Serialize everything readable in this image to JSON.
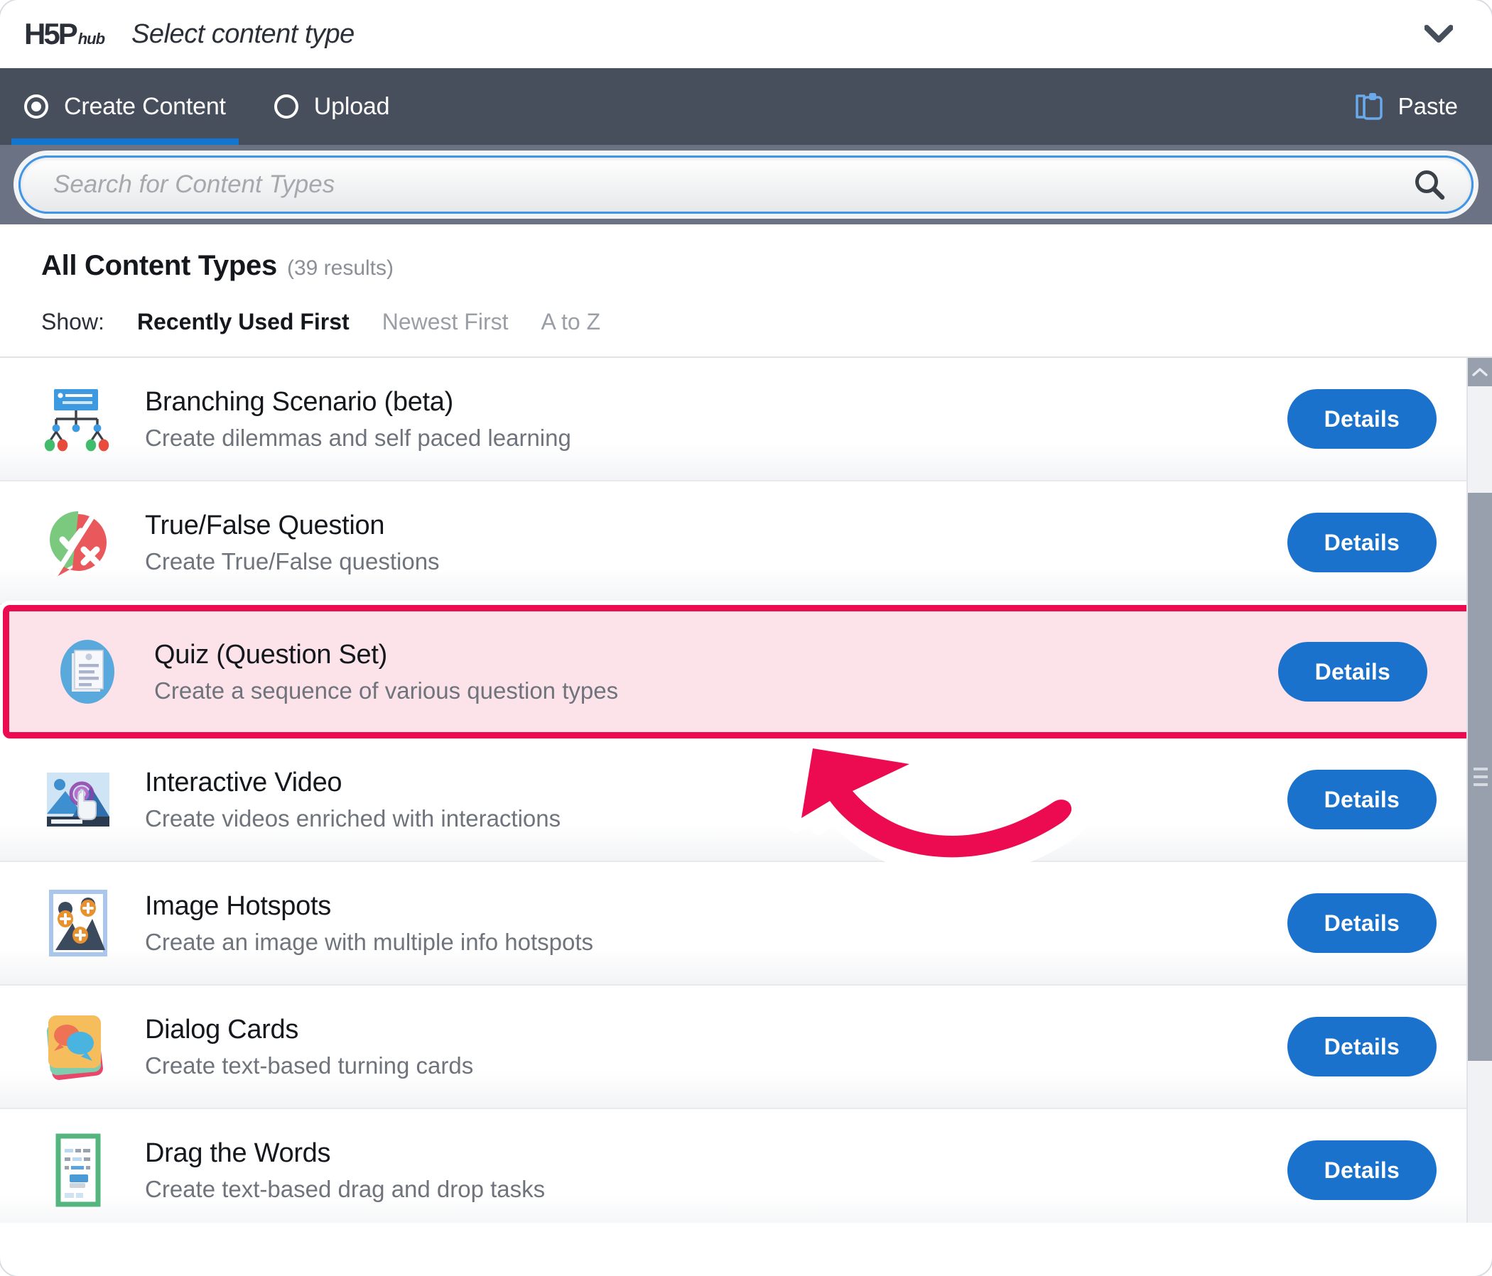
{
  "header": {
    "logo_main": "H5P",
    "logo_sub": "hub",
    "title": "Select content type",
    "collapse_icon": "chevron-down-icon"
  },
  "tabs": [
    {
      "label": "Create Content",
      "selected": true,
      "icon": "radio-selected-icon"
    },
    {
      "label": "Upload",
      "selected": false,
      "icon": "radio-unselected-icon"
    }
  ],
  "paste": {
    "label": "Paste",
    "icon": "clipboard-paste-icon"
  },
  "search": {
    "placeholder": "Search for Content Types",
    "value": "",
    "icon": "search-icon"
  },
  "results": {
    "title": "All Content Types",
    "count_label": "(39 results)",
    "show_label": "Show:",
    "sort_options": [
      {
        "label": "Recently Used First",
        "active": true
      },
      {
        "label": "Newest First",
        "active": false
      },
      {
        "label": "A to Z",
        "active": false
      }
    ]
  },
  "details_button_label": "Details",
  "content_types": [
    {
      "title": "Branching Scenario (beta)",
      "description": "Create dilemmas and self paced learning",
      "icon": "branching-scenario-icon",
      "highlighted": false
    },
    {
      "title": "True/False Question",
      "description": "Create True/False questions",
      "icon": "true-false-question-icon",
      "highlighted": false
    },
    {
      "title": "Quiz (Question Set)",
      "description": "Create a sequence of various question types",
      "icon": "quiz-question-set-icon",
      "highlighted": true
    },
    {
      "title": "Interactive Video",
      "description": "Create videos enriched with interactions",
      "icon": "interactive-video-icon",
      "highlighted": false
    },
    {
      "title": "Image Hotspots",
      "description": "Create an image with multiple info hotspots",
      "icon": "image-hotspots-icon",
      "highlighted": false
    },
    {
      "title": "Dialog Cards",
      "description": "Create text-based turning cards",
      "icon": "dialog-cards-icon",
      "highlighted": false
    },
    {
      "title": "Drag the Words",
      "description": "Create text-based drag and drop tasks",
      "icon": "drag-the-words-icon",
      "highlighted": false
    }
  ],
  "annotation": {
    "type": "curved-arrow",
    "points_to": "Quiz (Question Set)",
    "color": "#ec0b50"
  },
  "colors": {
    "tabbar_bg": "#474e5c",
    "searchband_bg": "#6b7283",
    "accent_blue": "#1a72cc",
    "tab_underline": "#1076d0",
    "highlight_border": "#ec0b50",
    "highlight_fill": "#fbe3e9",
    "paste_icon": "#6aaaea"
  },
  "scrollbar": {
    "up_arrow_icon": "chevron-up-icon",
    "thumb_grip_icon": "grip-lines-icon"
  }
}
